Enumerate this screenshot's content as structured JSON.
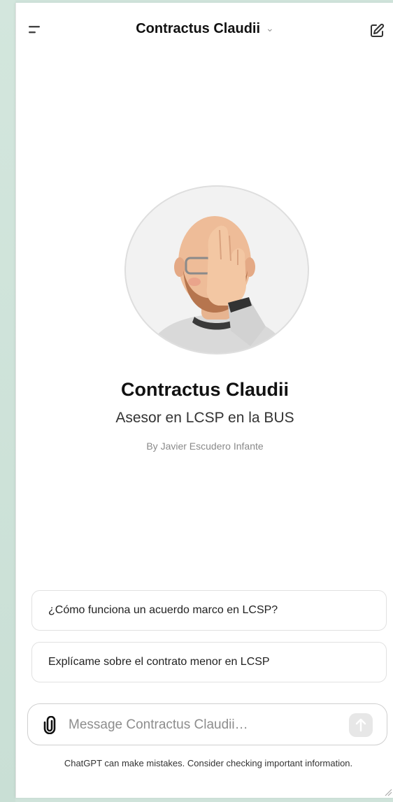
{
  "header": {
    "title": "Contractus Claudii",
    "menu_icon": "hamburger-menu-icon",
    "title_chevron": "⌄",
    "new_chat_icon": "edit-icon"
  },
  "gpt": {
    "name": "Contractus Claudii",
    "description": "Asesor en LCSP en la BUS",
    "author": "By Javier Escudero Infante"
  },
  "suggestions": [
    "¿Cómo funciona un acuerdo marco en LCSP?",
    "Explícame sobre el contrato menor en LCSP"
  ],
  "composer": {
    "placeholder": "Message Contractus Claudii…",
    "attach_icon": "paperclip-icon",
    "send_icon": "arrow-up-icon"
  },
  "footer": {
    "disclaimer": "ChatGPT can make mistakes. Consider checking important information."
  },
  "colors": {
    "background": "#cfe3da",
    "panel": "#ffffff",
    "send_button": "#e7e7e7"
  }
}
